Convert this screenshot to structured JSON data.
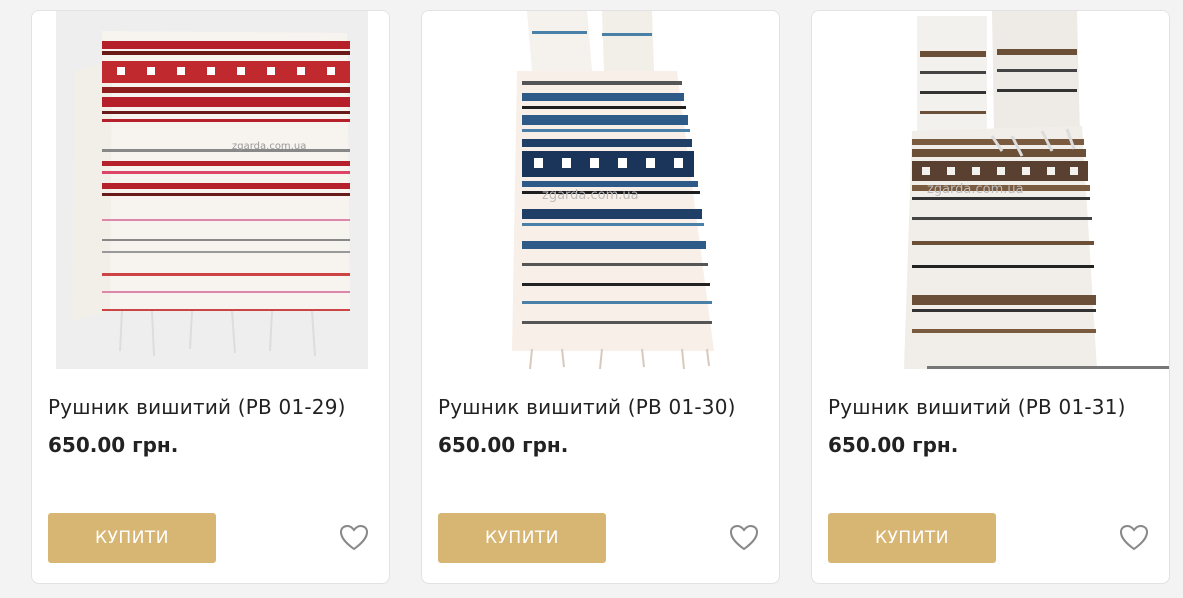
{
  "products": [
    {
      "title": "Рушник вишитий (РВ 01-29)",
      "price": "650.00 грн.",
      "buy_label": "КУПИТИ",
      "watermark": "zgarda.com.ua",
      "image": "red-woven-towel",
      "accent": "#b5202a"
    },
    {
      "title": "Рушник вишитий (РВ 01-30)",
      "price": "650.00 грн.",
      "buy_label": "КУПИТИ",
      "watermark": "zgarda.com.ua",
      "image": "blue-woven-towel",
      "accent": "#1f3f66"
    },
    {
      "title": "Рушник вишитий (РВ 01-31)",
      "price": "650.00 грн.",
      "buy_label": "КУПИТИ",
      "watermark": "zgarda.com.ua",
      "image": "brown-woven-towel",
      "accent": "#6b4f36"
    }
  ],
  "colors": {
    "button": "#d7b674",
    "heart": "#888888"
  },
  "icons": {
    "favorite": "heart-icon"
  }
}
